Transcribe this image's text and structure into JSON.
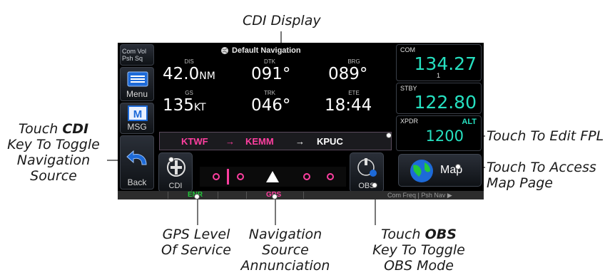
{
  "callouts": {
    "cdi_display": "CDI Display",
    "touch_cdi_pre": "Touch ",
    "touch_cdi_key": "CDI",
    "touch_cdi_line2": "Key To Toggle",
    "touch_cdi_line3": "Navigation",
    "touch_cdi_line4": "Source",
    "edit_fpl": "Touch To Edit FPL",
    "map_line1": "Touch To Access",
    "map_line2": "Map Page",
    "gps_line1": "GPS Level",
    "gps_line2": "Of Service",
    "nav_line1": "Navigation",
    "nav_line2": "Source",
    "nav_line3": "Annunciation",
    "obs_pre": "Touch ",
    "obs_key": "OBS",
    "obs_line2": "Key To Toggle",
    "obs_line3": "OBS Mode"
  },
  "screen": {
    "title": "Default Navigation",
    "keys": {
      "com_vol": "Com Vol",
      "psh_sq": "Psh Sq",
      "menu": "Menu",
      "msg": "MSG",
      "back": "Back"
    },
    "fields": {
      "dis_label": "DIS",
      "dis_value": "42.0",
      "dis_unit": "NM",
      "dtk_label": "DTK",
      "dtk_value": "091°",
      "brg_label": "BRG",
      "brg_value": "089°",
      "gs_label": "GS",
      "gs_value": "135",
      "gs_unit": "KT",
      "trk_label": "TRK",
      "trk_value": "046°",
      "ete_label": "ETE",
      "ete_value": "18:44"
    },
    "com": {
      "label": "COM",
      "freq": "134.27",
      "sub": "1"
    },
    "stby": {
      "label": "STBY",
      "freq": "122.80"
    },
    "xpdr": {
      "label": "XPDR",
      "mode": "ALT",
      "code": "1200"
    },
    "fpl": {
      "from": "KTWF",
      "arrow1": "→",
      "active": "KEMM",
      "arrow2": "→",
      "next": "KPUC"
    },
    "cdi_key": "CDI",
    "obs_key": "OBS",
    "map_key": "Map",
    "status": {
      "level": "ENR",
      "source": "GPS",
      "right_hint": "Com Freq | Psh Nav ▶"
    },
    "colors": {
      "freq": "#26e0c0",
      "magenta": "#ff3fa0",
      "green": "#23c83c"
    }
  }
}
